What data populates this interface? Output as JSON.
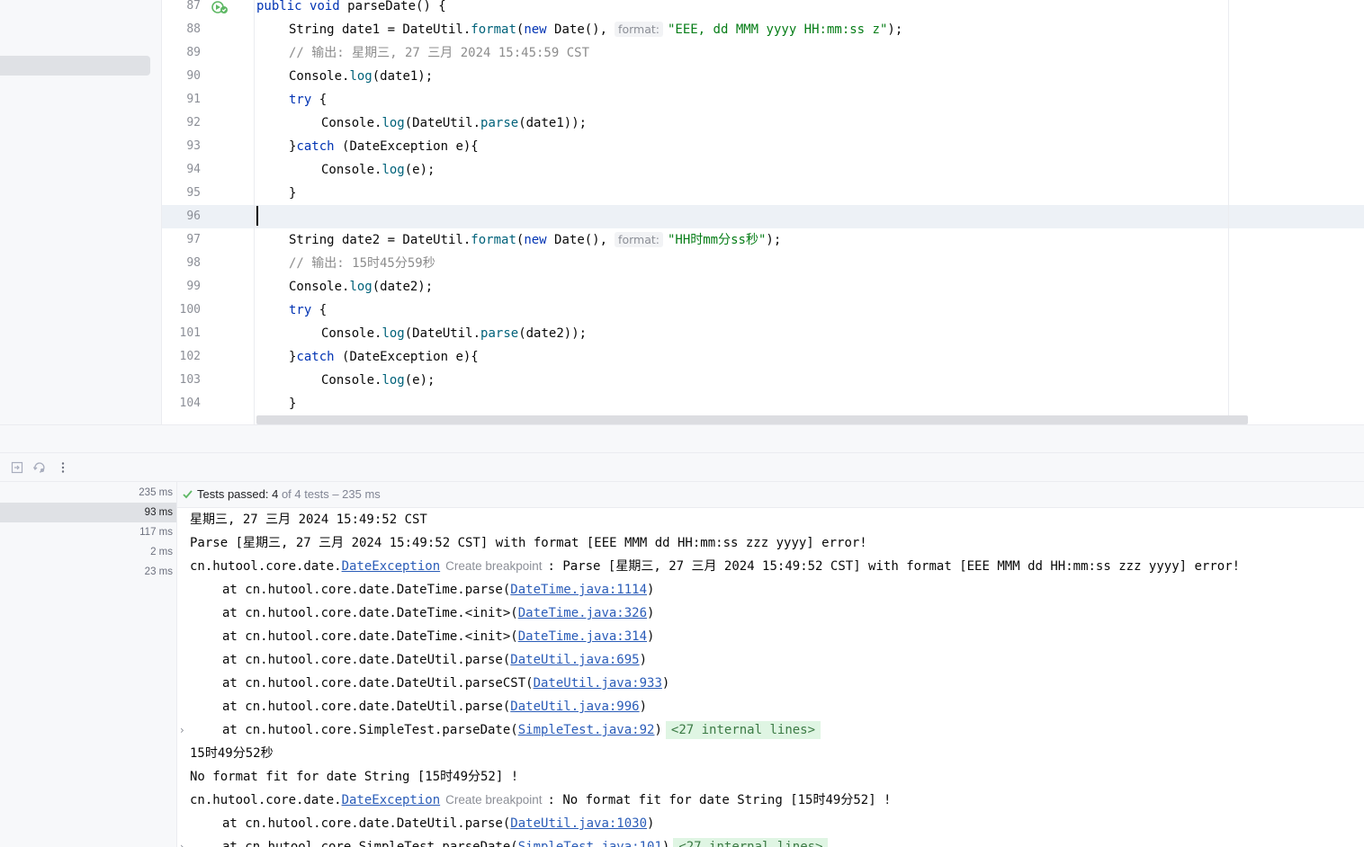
{
  "editor": {
    "lines": [
      {
        "no": "87",
        "segments": [
          [
            "kw",
            "public"
          ],
          [
            "",
            " "
          ],
          [
            "kw",
            "void"
          ],
          [
            "",
            " parseDate() {"
          ]
        ],
        "indent": 1
      },
      {
        "no": "88",
        "segments": [
          [
            "",
            "String date1 = DateUtil."
          ],
          [
            "fn",
            "format"
          ],
          [
            "",
            "("
          ],
          [
            "kw",
            "new"
          ],
          [
            "",
            " Date(),"
          ],
          [
            "hint",
            "format:"
          ],
          [
            "str",
            "\"EEE, dd MMM yyyy HH:mm:ss z\""
          ],
          [
            "",
            ");"
          ]
        ],
        "indent": 2
      },
      {
        "no": "89",
        "segments": [
          [
            "cmt",
            "// 输出: 星期三, 27 三月 2024 15:45:59 CST"
          ]
        ],
        "indent": 2
      },
      {
        "no": "90",
        "segments": [
          [
            "",
            "Console."
          ],
          [
            "fn",
            "log"
          ],
          [
            "",
            "(date1);"
          ]
        ],
        "indent": 2
      },
      {
        "no": "91",
        "segments": [
          [
            "kw",
            "try"
          ],
          [
            "",
            " {"
          ]
        ],
        "indent": 2
      },
      {
        "no": "92",
        "segments": [
          [
            "",
            "Console."
          ],
          [
            "fn",
            "log"
          ],
          [
            "",
            "(DateUtil."
          ],
          [
            "fn",
            "parse"
          ],
          [
            "",
            "(date1));"
          ]
        ],
        "indent": 3
      },
      {
        "no": "93",
        "segments": [
          [
            "",
            "}"
          ],
          [
            "kw",
            "catch"
          ],
          [
            "",
            " (DateException e){"
          ]
        ],
        "indent": 2
      },
      {
        "no": "94",
        "segments": [
          [
            "",
            "Console."
          ],
          [
            "fn",
            "log"
          ],
          [
            "",
            "(e);"
          ]
        ],
        "indent": 3
      },
      {
        "no": "95",
        "segments": [
          [
            "",
            "}"
          ]
        ],
        "indent": 2
      },
      {
        "no": "96",
        "segments": [],
        "indent": 0,
        "current": true
      },
      {
        "no": "97",
        "segments": [
          [
            "",
            "String date2 = DateUtil."
          ],
          [
            "fn",
            "format"
          ],
          [
            "",
            "("
          ],
          [
            "kw",
            "new"
          ],
          [
            "",
            " Date(),"
          ],
          [
            "hint",
            "format:"
          ],
          [
            "str",
            "\"HH时mm分ss秒\""
          ],
          [
            "",
            ");"
          ]
        ],
        "indent": 2
      },
      {
        "no": "98",
        "segments": [
          [
            "cmt",
            "// 输出: 15时45分59秒"
          ]
        ],
        "indent": 2
      },
      {
        "no": "99",
        "segments": [
          [
            "",
            "Console."
          ],
          [
            "fn",
            "log"
          ],
          [
            "",
            "(date2);"
          ]
        ],
        "indent": 2
      },
      {
        "no": "100",
        "segments": [
          [
            "kw",
            "try"
          ],
          [
            "",
            " {"
          ]
        ],
        "indent": 2
      },
      {
        "no": "101",
        "segments": [
          [
            "",
            "Console."
          ],
          [
            "fn",
            "log"
          ],
          [
            "",
            "(DateUtil."
          ],
          [
            "fn",
            "parse"
          ],
          [
            "",
            "(date2));"
          ]
        ],
        "indent": 3
      },
      {
        "no": "102",
        "segments": [
          [
            "",
            "}"
          ],
          [
            "kw",
            "catch"
          ],
          [
            "",
            " (DateException e){"
          ]
        ],
        "indent": 2
      },
      {
        "no": "103",
        "segments": [
          [
            "",
            "Console."
          ],
          [
            "fn",
            "log"
          ],
          [
            "",
            "(e);"
          ]
        ],
        "indent": 3
      },
      {
        "no": "104",
        "segments": [
          [
            "",
            "}"
          ]
        ],
        "indent": 2
      }
    ]
  },
  "test_tree": {
    "rows": [
      {
        "time": "235 ms",
        "selected": false
      },
      {
        "time": "93 ms",
        "selected": true
      },
      {
        "time": "117 ms",
        "selected": false
      },
      {
        "time": "2 ms",
        "selected": false
      },
      {
        "time": "23 ms",
        "selected": false
      }
    ]
  },
  "status": {
    "label": "Tests passed: ",
    "passed": "4",
    "rest": " of 4 tests – 235 ms"
  },
  "console": {
    "lines": [
      {
        "parts": [
          [
            "",
            "星期三, 27 三月 2024 15:49:52 CST"
          ]
        ]
      },
      {
        "parts": [
          [
            "",
            "Parse [星期三, 27 三月 2024 15:49:52 CST] with format [EEE MMM dd HH:mm:ss zzz yyyy] error!"
          ]
        ]
      },
      {
        "parts": [
          [
            "",
            "cn.hutool.core.date."
          ],
          [
            "link",
            "DateException"
          ],
          [
            "cbp",
            "Create breakpoint"
          ],
          [
            "",
            ": Parse [星期三, 27 三月 2024 15:49:52 CST] with format [EEE MMM dd HH:mm:ss zzz yyyy] error!"
          ]
        ]
      },
      {
        "indent": true,
        "parts": [
          [
            "",
            "at cn.hutool.core.date.DateTime.parse("
          ],
          [
            "link",
            "DateTime.java:1114"
          ],
          [
            "",
            ")"
          ]
        ]
      },
      {
        "indent": true,
        "parts": [
          [
            "",
            "at cn.hutool.core.date.DateTime.<init>("
          ],
          [
            "link",
            "DateTime.java:326"
          ],
          [
            "",
            ")"
          ]
        ]
      },
      {
        "indent": true,
        "parts": [
          [
            "",
            "at cn.hutool.core.date.DateTime.<init>("
          ],
          [
            "link",
            "DateTime.java:314"
          ],
          [
            "",
            ")"
          ]
        ]
      },
      {
        "indent": true,
        "parts": [
          [
            "",
            "at cn.hutool.core.date.DateUtil.parse("
          ],
          [
            "link",
            "DateUtil.java:695"
          ],
          [
            "",
            ")"
          ]
        ]
      },
      {
        "indent": true,
        "parts": [
          [
            "",
            "at cn.hutool.core.date.DateUtil.parseCST("
          ],
          [
            "link",
            "DateUtil.java:933"
          ],
          [
            "",
            ")"
          ]
        ]
      },
      {
        "indent": true,
        "parts": [
          [
            "",
            "at cn.hutool.core.date.DateUtil.parse("
          ],
          [
            "link",
            "DateUtil.java:996"
          ],
          [
            "",
            ")"
          ]
        ]
      },
      {
        "indent": true,
        "expander": "›",
        "parts": [
          [
            "",
            "at cn.hutool.core.SimpleTest.parseDate("
          ],
          [
            "link",
            "SimpleTest.java:92"
          ],
          [
            "",
            ")"
          ],
          [
            "internal",
            "<27 internal lines>"
          ]
        ]
      },
      {
        "parts": [
          [
            "",
            "15时49分52秒"
          ]
        ]
      },
      {
        "parts": [
          [
            "",
            "No format fit for date String [15时49分52] !"
          ]
        ]
      },
      {
        "parts": [
          [
            "",
            "cn.hutool.core.date."
          ],
          [
            "link",
            "DateException"
          ],
          [
            "cbp",
            "Create breakpoint"
          ],
          [
            "",
            ": No format fit for date String [15时49分52] !"
          ]
        ]
      },
      {
        "indent": true,
        "parts": [
          [
            "",
            "at cn.hutool.core.date.DateUtil.parse("
          ],
          [
            "link",
            "DateUtil.java:1030"
          ],
          [
            "",
            ")"
          ]
        ]
      },
      {
        "indent": true,
        "expander": "›",
        "parts": [
          [
            "",
            "at cn.hutool.core.SimpleTest.parseDate("
          ],
          [
            "link",
            "SimpleTest.java:101"
          ],
          [
            "",
            ")"
          ],
          [
            "internal",
            "<27 internal lines>"
          ]
        ]
      }
    ]
  },
  "icons": {
    "run_gutter": "run-test-gutter-icon",
    "restore_layout": "restore-layout-icon",
    "rerun": "rerun-icon",
    "more": "more-options-icon",
    "tests_passed": "check-icon"
  },
  "colors": {
    "keyword": "#0033b3",
    "method": "#00627a",
    "string": "#067d17",
    "comment": "#8c8c8c",
    "link": "#2a5cb8",
    "pass": "#5fb865"
  }
}
